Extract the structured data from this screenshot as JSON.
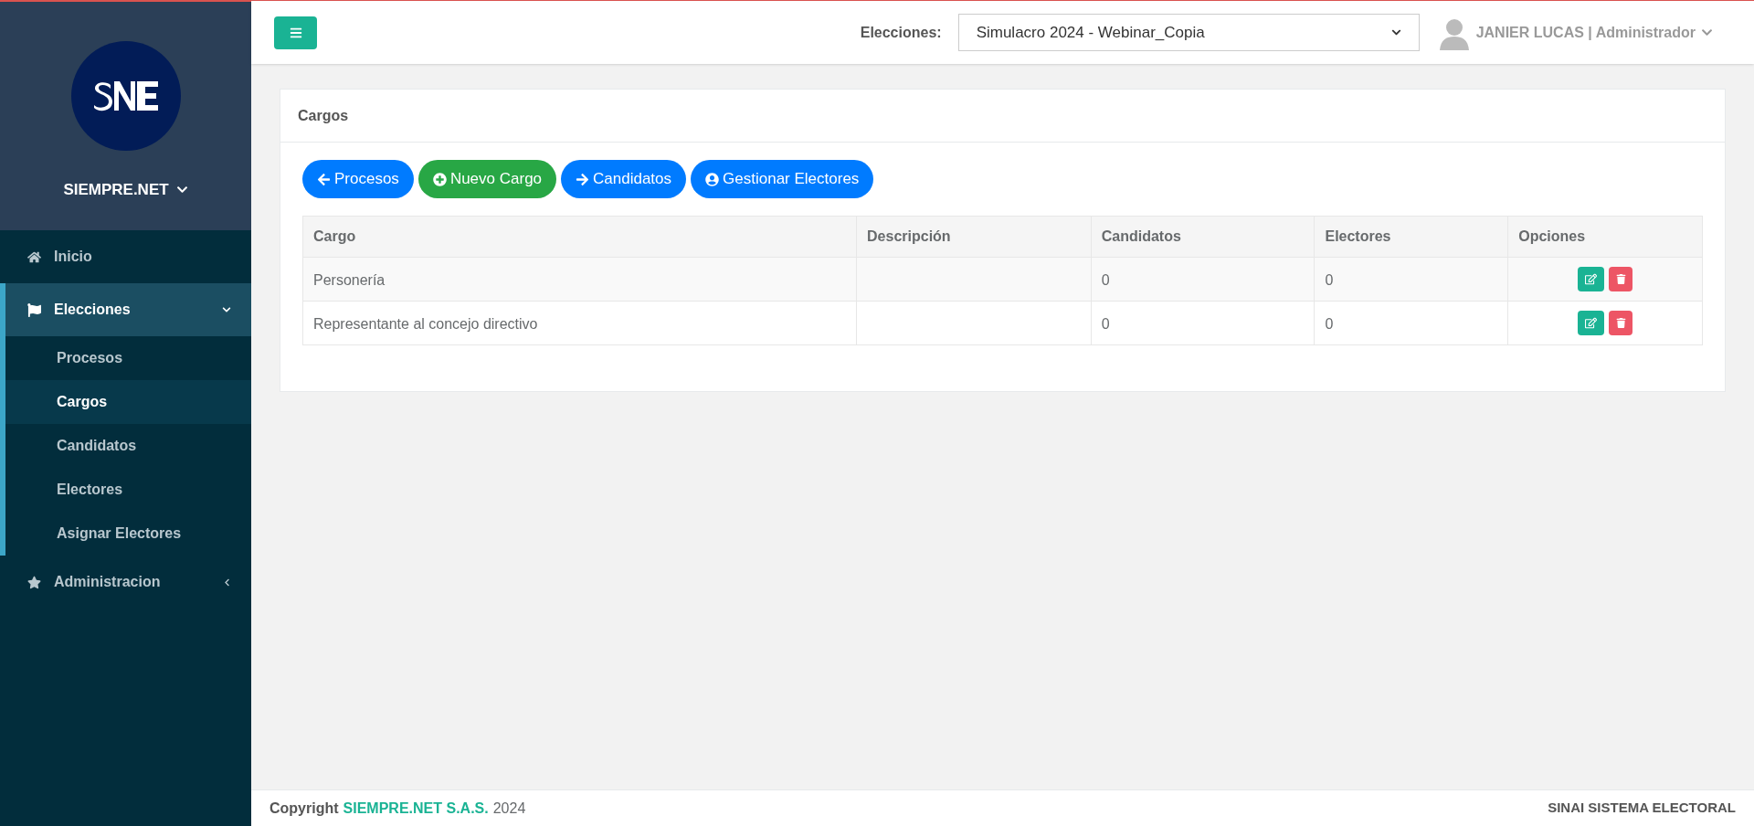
{
  "sidebar": {
    "brand": "SIEMPRE.NET",
    "items": [
      {
        "label": "Inicio",
        "selected": false
      },
      {
        "label": "Elecciones",
        "selected": true,
        "expanded": true,
        "children": [
          {
            "label": "Procesos",
            "selected": false
          },
          {
            "label": "Cargos",
            "selected": true
          },
          {
            "label": "Candidatos",
            "selected": false
          },
          {
            "label": "Electores",
            "selected": false
          },
          {
            "label": "Asignar Electores",
            "selected": false
          }
        ]
      },
      {
        "label": "Administracion",
        "selected": false,
        "expanded": false
      }
    ]
  },
  "header": {
    "elections_label": "Elecciones:",
    "election_value": "Simulacro 2024 - Webinar_Copia",
    "user": "JANIER LUCAS | Administrador"
  },
  "panel": {
    "title": "Cargos",
    "buttons": [
      {
        "label": "Procesos",
        "kind": "back"
      },
      {
        "label": "Nuevo Cargo",
        "kind": "new"
      },
      {
        "label": "Candidatos",
        "kind": "forward"
      },
      {
        "label": "Gestionar Electores",
        "kind": "user"
      }
    ],
    "table": {
      "columns": [
        "Cargo",
        "Descripción",
        "Candidatos",
        "Electores",
        "Opciones"
      ],
      "rows": [
        {
          "cargo": "Personería",
          "descripcion": "",
          "candidatos": "0",
          "electores": "0"
        },
        {
          "cargo": "Representante al concejo directivo",
          "descripcion": "",
          "candidatos": "0",
          "electores": "0"
        }
      ]
    }
  },
  "footer": {
    "copyright": "Copyright",
    "company": "SIEMPRE.NET S.A.S.",
    "year": "2024",
    "right": "SINAI SISTEMA ELECTORAL"
  }
}
